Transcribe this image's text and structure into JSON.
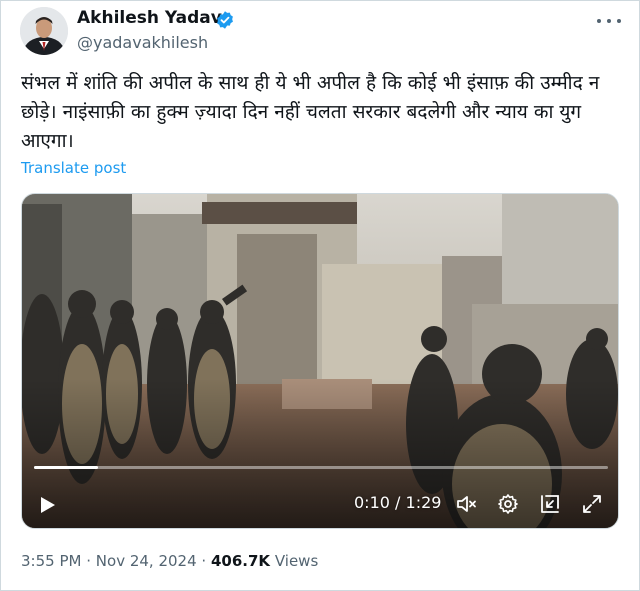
{
  "author": {
    "name": "Akhilesh Yadav",
    "handle": "@yadavakhilesh",
    "verified": true
  },
  "tweet": {
    "text": "संभल में शांति की अपील के साथ ही ये भी अपील है कि कोई भी इंसाफ़ की उम्मीद न छोड़े। नाइंसाफ़ी का हुक्म ज़्यादा दिन नहीं चलता सरकार बदलेगी और न्याय का युग आएगा।",
    "translate_label": "Translate post"
  },
  "video": {
    "current_time": "0:10",
    "separator": "/",
    "duration": "1:29",
    "progress_fraction": 0.112
  },
  "meta": {
    "time": "3:55 PM",
    "dot1": "·",
    "date": "Nov 24, 2024",
    "dot2": "·",
    "views_count": "406.7K",
    "views_label": "Views"
  },
  "colors": {
    "accent": "#1d9bf0",
    "secondary_text": "#536471",
    "primary_text": "#0f1419"
  },
  "icons": [
    "verified-badge-icon",
    "more-icon",
    "play-icon",
    "mute-icon",
    "settings-icon",
    "pip-icon",
    "fullscreen-icon"
  ]
}
